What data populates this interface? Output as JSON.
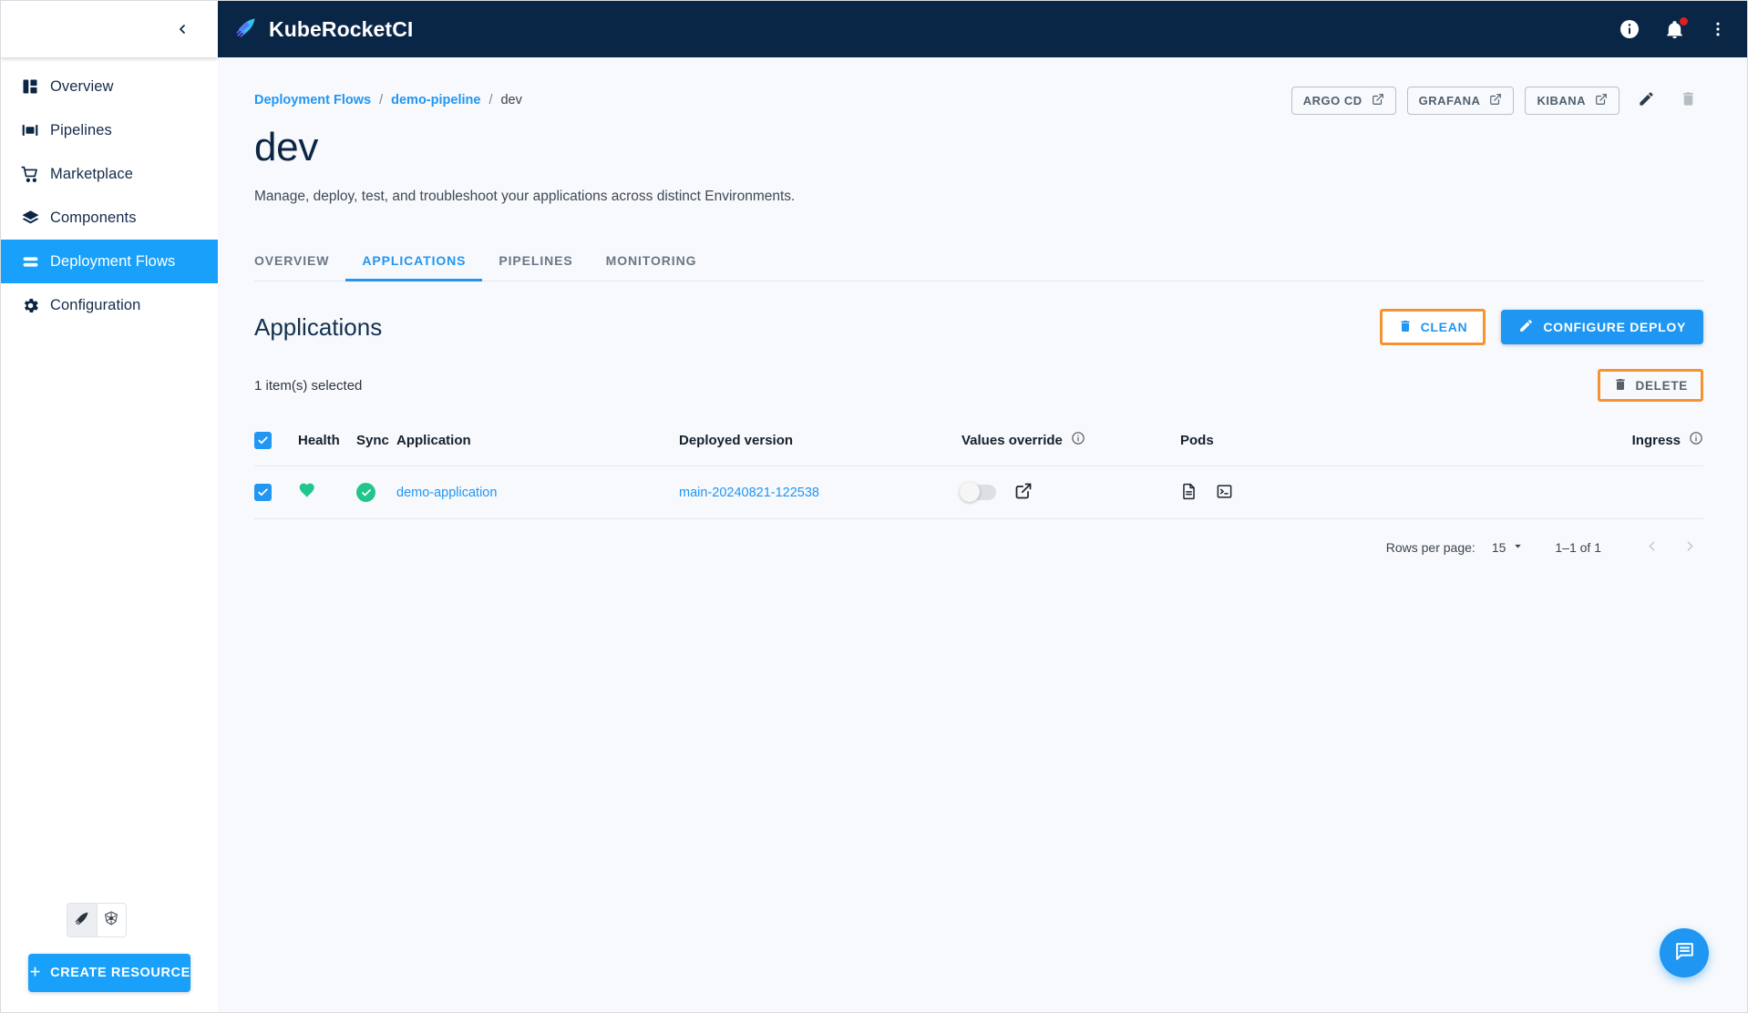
{
  "app": {
    "brand_name": "KubeRocketCI",
    "logo_icon": "rocket-feather-icon"
  },
  "sidebar": {
    "collapse_icon": "chevron-left-icon",
    "items": [
      {
        "label": "Overview",
        "icon": "dashboard-icon",
        "active": false
      },
      {
        "label": "Pipelines",
        "icon": "pipelines-icon",
        "active": false
      },
      {
        "label": "Marketplace",
        "icon": "cart-icon",
        "active": false
      },
      {
        "label": "Components",
        "icon": "layers-icon",
        "active": false
      },
      {
        "label": "Deployment Flows",
        "icon": "flows-icon",
        "active": true
      },
      {
        "label": "Configuration",
        "icon": "gear-icon",
        "active": false
      }
    ],
    "cluster_switch": [
      {
        "icon": "rocket-feather-icon",
        "selected": true
      },
      {
        "icon": "kubernetes-icon",
        "selected": false
      }
    ],
    "create_resource_label": "CREATE RESOURCE",
    "create_resource_icon": "plus-icon"
  },
  "topbar": {
    "icons": [
      {
        "name": "info-icon"
      },
      {
        "name": "bell-icon",
        "has_badge": true
      },
      {
        "name": "more-vertical-icon"
      }
    ]
  },
  "breadcrumb": {
    "items": [
      {
        "label": "Deployment Flows",
        "link": true
      },
      {
        "label": "demo-pipeline",
        "link": true
      },
      {
        "label": "dev",
        "link": false
      }
    ],
    "separator": "/"
  },
  "top_actions": {
    "buttons": [
      {
        "label": "ARGO CD",
        "icon": "external-link-icon"
      },
      {
        "label": "GRAFANA",
        "icon": "external-link-icon"
      },
      {
        "label": "KIBANA",
        "icon": "external-link-icon"
      }
    ],
    "edit_icon": "pencil-icon",
    "delete_icon": "trash-icon"
  },
  "page": {
    "title": "dev",
    "description": "Manage, deploy, test, and troubleshoot your applications across distinct Environments."
  },
  "tabs": [
    {
      "label": "OVERVIEW",
      "active": false
    },
    {
      "label": "APPLICATIONS",
      "active": true
    },
    {
      "label": "PIPELINES",
      "active": false
    },
    {
      "label": "MONITORING",
      "active": false
    }
  ],
  "applications": {
    "section_title": "Applications",
    "clean_button": {
      "label": "CLEAN",
      "icon": "trash-icon",
      "highlighted": true,
      "highlight_color": "#f59331"
    },
    "configure_button": {
      "label": "CONFIGURE DEPLOY",
      "icon": "pencil-icon",
      "color": "#1e96f2"
    },
    "selection_text": "1 item(s) selected",
    "delete_button": {
      "label": "DELETE",
      "icon": "trash-icon",
      "highlighted": true,
      "highlight_color": "#f59331"
    },
    "columns": [
      {
        "key": "checkbox",
        "label": ""
      },
      {
        "key": "health",
        "label": "Health"
      },
      {
        "key": "sync",
        "label": "Sync"
      },
      {
        "key": "application",
        "label": "Application"
      },
      {
        "key": "deployed_version",
        "label": "Deployed version"
      },
      {
        "key": "values_override",
        "label": "Values override",
        "info_icon": "info-outline-icon"
      },
      {
        "key": "pods",
        "label": "Pods"
      },
      {
        "key": "ingress",
        "label": "Ingress",
        "info_icon": "info-outline-icon"
      }
    ],
    "header_checkbox_checked": true,
    "rows": [
      {
        "checked": true,
        "health": {
          "icon": "heart-icon",
          "color": "#22c58b",
          "status": "healthy"
        },
        "sync": {
          "icon": "check-circle-icon",
          "color": "#22c58b",
          "status": "synced"
        },
        "application": "demo-application",
        "deployed_version": "main-20240821-122538",
        "values_override": {
          "toggle_on": false,
          "external_link_icon": "external-link-icon"
        },
        "pods": [
          "document-icon",
          "terminal-icon"
        ],
        "ingress": ""
      }
    ],
    "pagination": {
      "rows_per_page_label": "Rows per page:",
      "rows_per_page_value": "15",
      "dropdown_icon": "chevron-down-icon",
      "range_text": "1–1 of 1",
      "prev_icon": "chevron-left-icon",
      "next_icon": "chevron-right-icon"
    }
  },
  "fab": {
    "icon": "chat-icon",
    "color": "#1e96f2"
  }
}
